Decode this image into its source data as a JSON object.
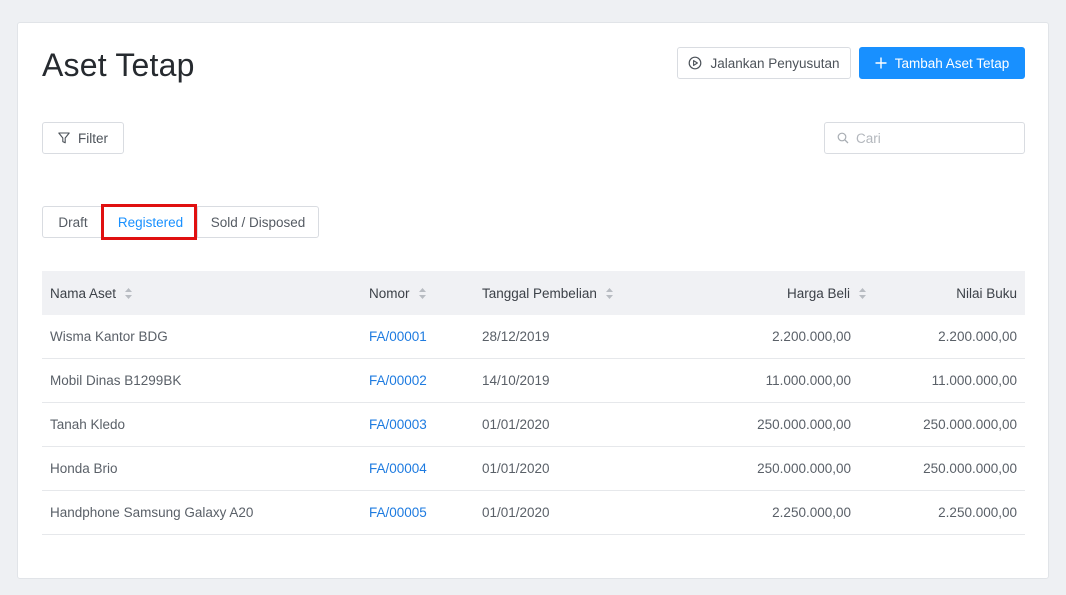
{
  "page": {
    "title": "Aset Tetap"
  },
  "actions": {
    "run_depreciation_label": "Jalankan Penyusutan",
    "add_asset_label": "Tambah Aset Tetap",
    "filter_label": "Filter"
  },
  "search": {
    "placeholder": "Cari",
    "value": ""
  },
  "tabs": [
    {
      "label": "Draft"
    },
    {
      "label": "Registered",
      "active": true
    },
    {
      "label": "Sold / Disposed"
    }
  ],
  "table": {
    "columns": [
      {
        "label": "Nama Aset",
        "sortable": true
      },
      {
        "label": "Nomor",
        "sortable": true
      },
      {
        "label": "Tanggal Pembelian",
        "sortable": true
      },
      {
        "label": "Harga Beli",
        "sortable": true
      },
      {
        "label": "Nilai Buku",
        "sortable": false
      }
    ],
    "rows": [
      {
        "name": "Wisma Kantor BDG",
        "number": "FA/00001",
        "date": "28/12/2019",
        "price": "2.200.000,00",
        "book_value": "2.200.000,00"
      },
      {
        "name": "Mobil Dinas B1299BK",
        "number": "FA/00002",
        "date": "14/10/2019",
        "price": "11.000.000,00",
        "book_value": "11.000.000,00"
      },
      {
        "name": "Tanah Kledo",
        "number": "FA/00003",
        "date": "01/01/2020",
        "price": "250.000.000,00",
        "book_value": "250.000.000,00"
      },
      {
        "name": "Honda Brio",
        "number": "FA/00004",
        "date": "01/01/2020",
        "price": "250.000.000,00",
        "book_value": "250.000.000,00"
      },
      {
        "name": "Handphone Samsung Galaxy A20",
        "number": "FA/00005",
        "date": "01/01/2020",
        "price": "2.250.000,00",
        "book_value": "2.250.000,00"
      }
    ]
  },
  "colors": {
    "primary": "#1890ff",
    "link": "#1e7be0",
    "highlight": "#e01010"
  },
  "icons": {
    "run": "play-circle-icon",
    "add": "plus-icon",
    "filter": "funnel-icon",
    "search": "search-icon",
    "sort": "sort-icon"
  }
}
